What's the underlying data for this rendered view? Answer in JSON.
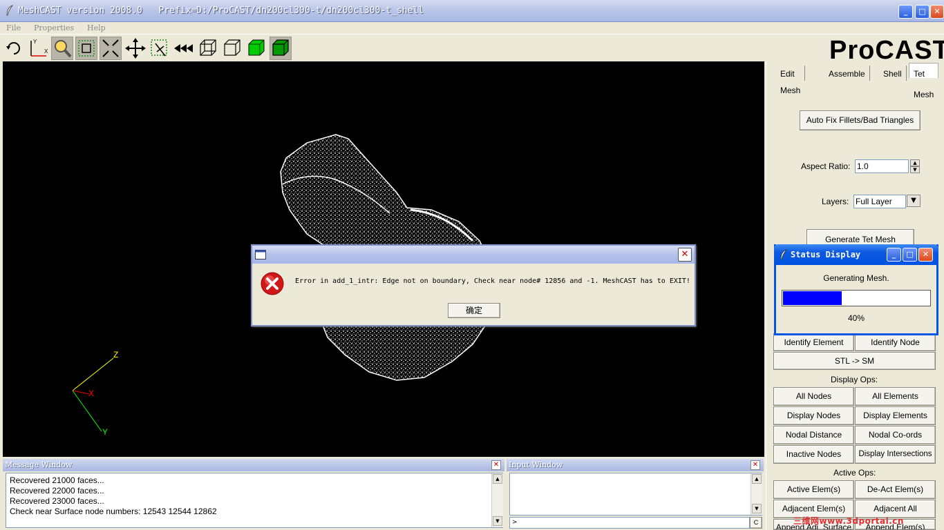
{
  "window": {
    "title": "MeshCAST version 2008.0   Prefix=D:/ProCAST/dn200cl300-t/dn200cl300-t_shell",
    "minimize": "_",
    "maximize": "□",
    "close": "✕"
  },
  "menu": [
    "File",
    "Properties",
    "Help"
  ],
  "logo": "ProCAST",
  "tabs": [
    "Edit Mesh",
    "Assemble",
    "Shell",
    "Tet Mesh"
  ],
  "tet_mesh": {
    "auto_fix_label": "Auto Fix Fillets/Bad Triangles",
    "aspect_ratio_label": "Aspect Ratio:",
    "aspect_ratio_value": "1.0",
    "layers_label": "Layers:",
    "layers_value": "Full Layer",
    "generate_label": "Generate Tet Mesh"
  },
  "ops": {
    "identify_element": "Identify Element",
    "identify_node": "Identify Node",
    "stl_sm": "STL -> SM",
    "display_ops_header": "Display Ops:",
    "all_nodes": "All Nodes",
    "all_elements": "All Elements",
    "display_nodes": "Display Nodes",
    "display_elements": "Display Elements",
    "nodal_distance": "Nodal Distance",
    "nodal_coords": "Nodal Co-ords",
    "inactive_nodes": "Inactive Nodes",
    "display_intersections": "Display Intersections",
    "active_ops_header": "Active Ops:",
    "active_elems": "Active Elem(s)",
    "deact_elems": "De-Act Elem(s)",
    "adjacent_elems": "Adjacent Elem(s)",
    "adjacent_all": "Adjacent All",
    "append_adj_surface": "Append Adj. Surface",
    "append_elems": "Append Elem(s)"
  },
  "axes": {
    "z": "Z",
    "x": "X",
    "y": "Y"
  },
  "message_window": {
    "title": "Message Window",
    "lines": [
      "Recovered 21000 faces...",
      "Recovered 22000 faces...",
      "Recovered 23000 faces...",
      "Check near Surface node numbers: 12543 12544 12862"
    ]
  },
  "input_window": {
    "title": "Input Window",
    "prompt": ">",
    "clear_label": "C"
  },
  "error_dialog": {
    "message": "Error in add_1_intr: Edge not on boundary, Check near node# 12856 and -1. MeshCAST has to EXIT!",
    "ok_label": "确定"
  },
  "status_display": {
    "title": "Status Display",
    "message": "Generating Mesh.",
    "progress_percent": 40,
    "progress_text": "40%"
  },
  "watermark": "三维网www.3dportal.cn",
  "colors": {
    "axis_z": "#ffff00",
    "axis_x": "#ff0000",
    "axis_y": "#00ff00",
    "progress_fill": "#0000ff",
    "viewport_bg": "#000000"
  }
}
